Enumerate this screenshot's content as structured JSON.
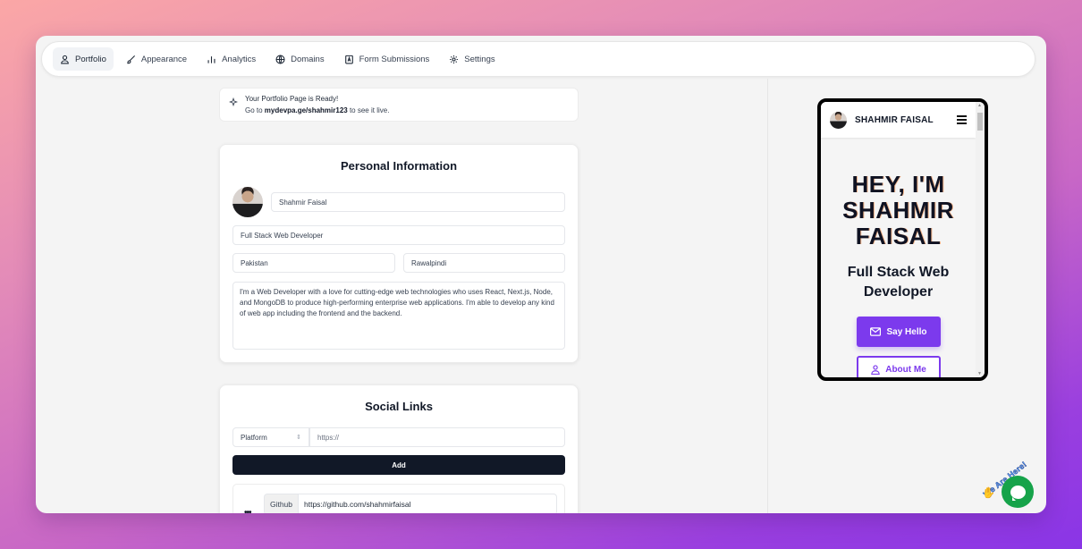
{
  "nav": {
    "items": [
      {
        "label": "Portfolio",
        "icon": "user-icon",
        "active": true
      },
      {
        "label": "Appearance",
        "icon": "brush-icon",
        "active": false
      },
      {
        "label": "Analytics",
        "icon": "bar-chart-icon",
        "active": false
      },
      {
        "label": "Domains",
        "icon": "globe-icon",
        "active": false
      },
      {
        "label": "Form Submissions",
        "icon": "form-icon",
        "active": false
      },
      {
        "label": "Settings",
        "icon": "gear-icon",
        "active": false
      }
    ]
  },
  "banner": {
    "icon": "sparkle-icon",
    "title": "Your Portfolio Page is Ready!",
    "prefix": "Go to ",
    "link": "mydevpa.ge/shahmir123",
    "suffix": " to see it live."
  },
  "personal_info": {
    "title": "Personal Information",
    "name": "Shahmir Faisal",
    "headline": "Full Stack Web Developer",
    "country": "Pakistan",
    "city": "Rawalpindi",
    "bio": "I'm a Web Developer with a love for cutting-edge web technologies who uses React, Next.js, Node, and MongoDB to produce high-performing enterprise web applications. I'm able to develop any kind of web app including the frontend and the backend."
  },
  "social_links": {
    "title": "Social Links",
    "platform_placeholder": "Platform",
    "url_placeholder": "https://",
    "add_label": "Add",
    "links": [
      {
        "platform": "Github",
        "url": "https://github.com/shahmirfaisal"
      }
    ]
  },
  "preview": {
    "header_name": "SHAHMIR FAISAL",
    "hero_line1": "HEY, I'M",
    "hero_line2": "SHAHMIR",
    "hero_line3": "FAISAL",
    "subtitle_line1": "Full Stack Web",
    "subtitle_line2": "Developer",
    "say_hello_label": "Say Hello",
    "about_me_label": "About Me",
    "accent": "#7c3aed"
  },
  "chat_widget": {
    "label": "We Are Here!",
    "color": "#16a34a"
  }
}
